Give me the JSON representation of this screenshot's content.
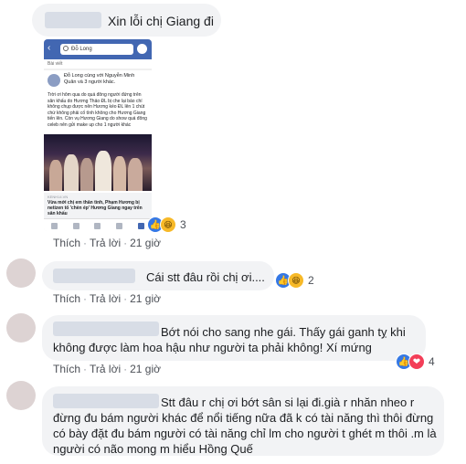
{
  "comments": [
    {
      "text": "Xin lỗi chị Giang đi",
      "reactions": {
        "icons": [
          "like-icon",
          "haha-icon"
        ],
        "count": "3"
      },
      "actions": {
        "like": "Thích",
        "reply": "Trả lời",
        "time": "21 giờ"
      },
      "attachment": {
        "search": "Đỗ Long",
        "subtitle": "Bài viết",
        "post_author": "Đỗ Long cùng với Nguyễn Minh Quân và 3 người khác.",
        "post_text": "Trời ơi hôm qua do quá đông người đứng trên sân khấu do Hương Thảo ĐL bị che lại báo chí không chụp được nên Hương kéo ĐL lên 1 chút chứ không phải cố tình không cho Hương Giang tiến lên. Còn vụ Hương Giang do show quá đông celeb nên gửi make up cho 1 người khác",
        "link_tag": "KENH14.VN",
        "link_title": "Vừa mới chị em thân tình, Phạm Hương bị netizen tố 'chèn ép' Hương Giang ngay trên sân khấu"
      }
    },
    {
      "text": "Cái stt đâu rồi chị ơi....",
      "reactions": {
        "icons": [
          "like-icon",
          "haha-icon"
        ],
        "count": "2"
      },
      "actions": {
        "like": "Thích",
        "reply": "Trả lời",
        "time": "21 giờ"
      }
    },
    {
      "text": "Bớt nói cho sang nhe gái. Thấy gái ganh tỵ khi không được làm hoa hậu như người ta phải không! Xí mứng",
      "reactions": {
        "icons": [
          "like-icon",
          "love-icon"
        ],
        "count": "4"
      },
      "actions": {
        "like": "Thích",
        "reply": "Trả lời",
        "time": "21 giờ"
      }
    },
    {
      "text": "Stt đâu r chị ơi bớt sân si lại đi.già r nhăn nheo r đừng đu bám người khác để nổi tiếng nữa đã k có tài năng thì thôi đừng có bày đặt đu bám người có tài năng chỉ lm cho người t ghét m thôi .m là người có não mong m hiểu Hồng Quế"
    }
  ],
  "colors": {
    "bubble": "#f2f3f5",
    "like": "#3578e5",
    "haha": "#f7b928",
    "love": "#f33e58",
    "fb_blue": "#4267b2"
  }
}
